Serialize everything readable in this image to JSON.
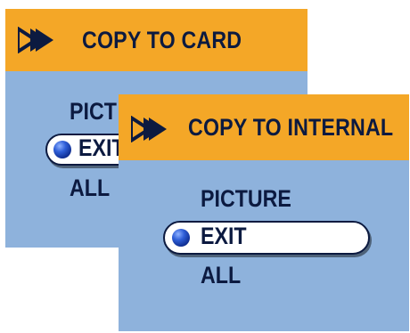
{
  "colors": {
    "header": "#f4a727",
    "body": "#8eb2dc",
    "ink": "#0c1a40",
    "pill": "#ffffff"
  },
  "back_screen": {
    "icon": "double-arrow-icon",
    "title": "COPY TO CARD",
    "items": [
      "PICT",
      "EXIT",
      "ALL"
    ],
    "selected_index": 1
  },
  "front_screen": {
    "icon": "double-arrow-icon",
    "title": "COPY TO INTERNAL",
    "items": [
      "PICTURE",
      "EXIT",
      "ALL"
    ],
    "selected_index": 1
  }
}
